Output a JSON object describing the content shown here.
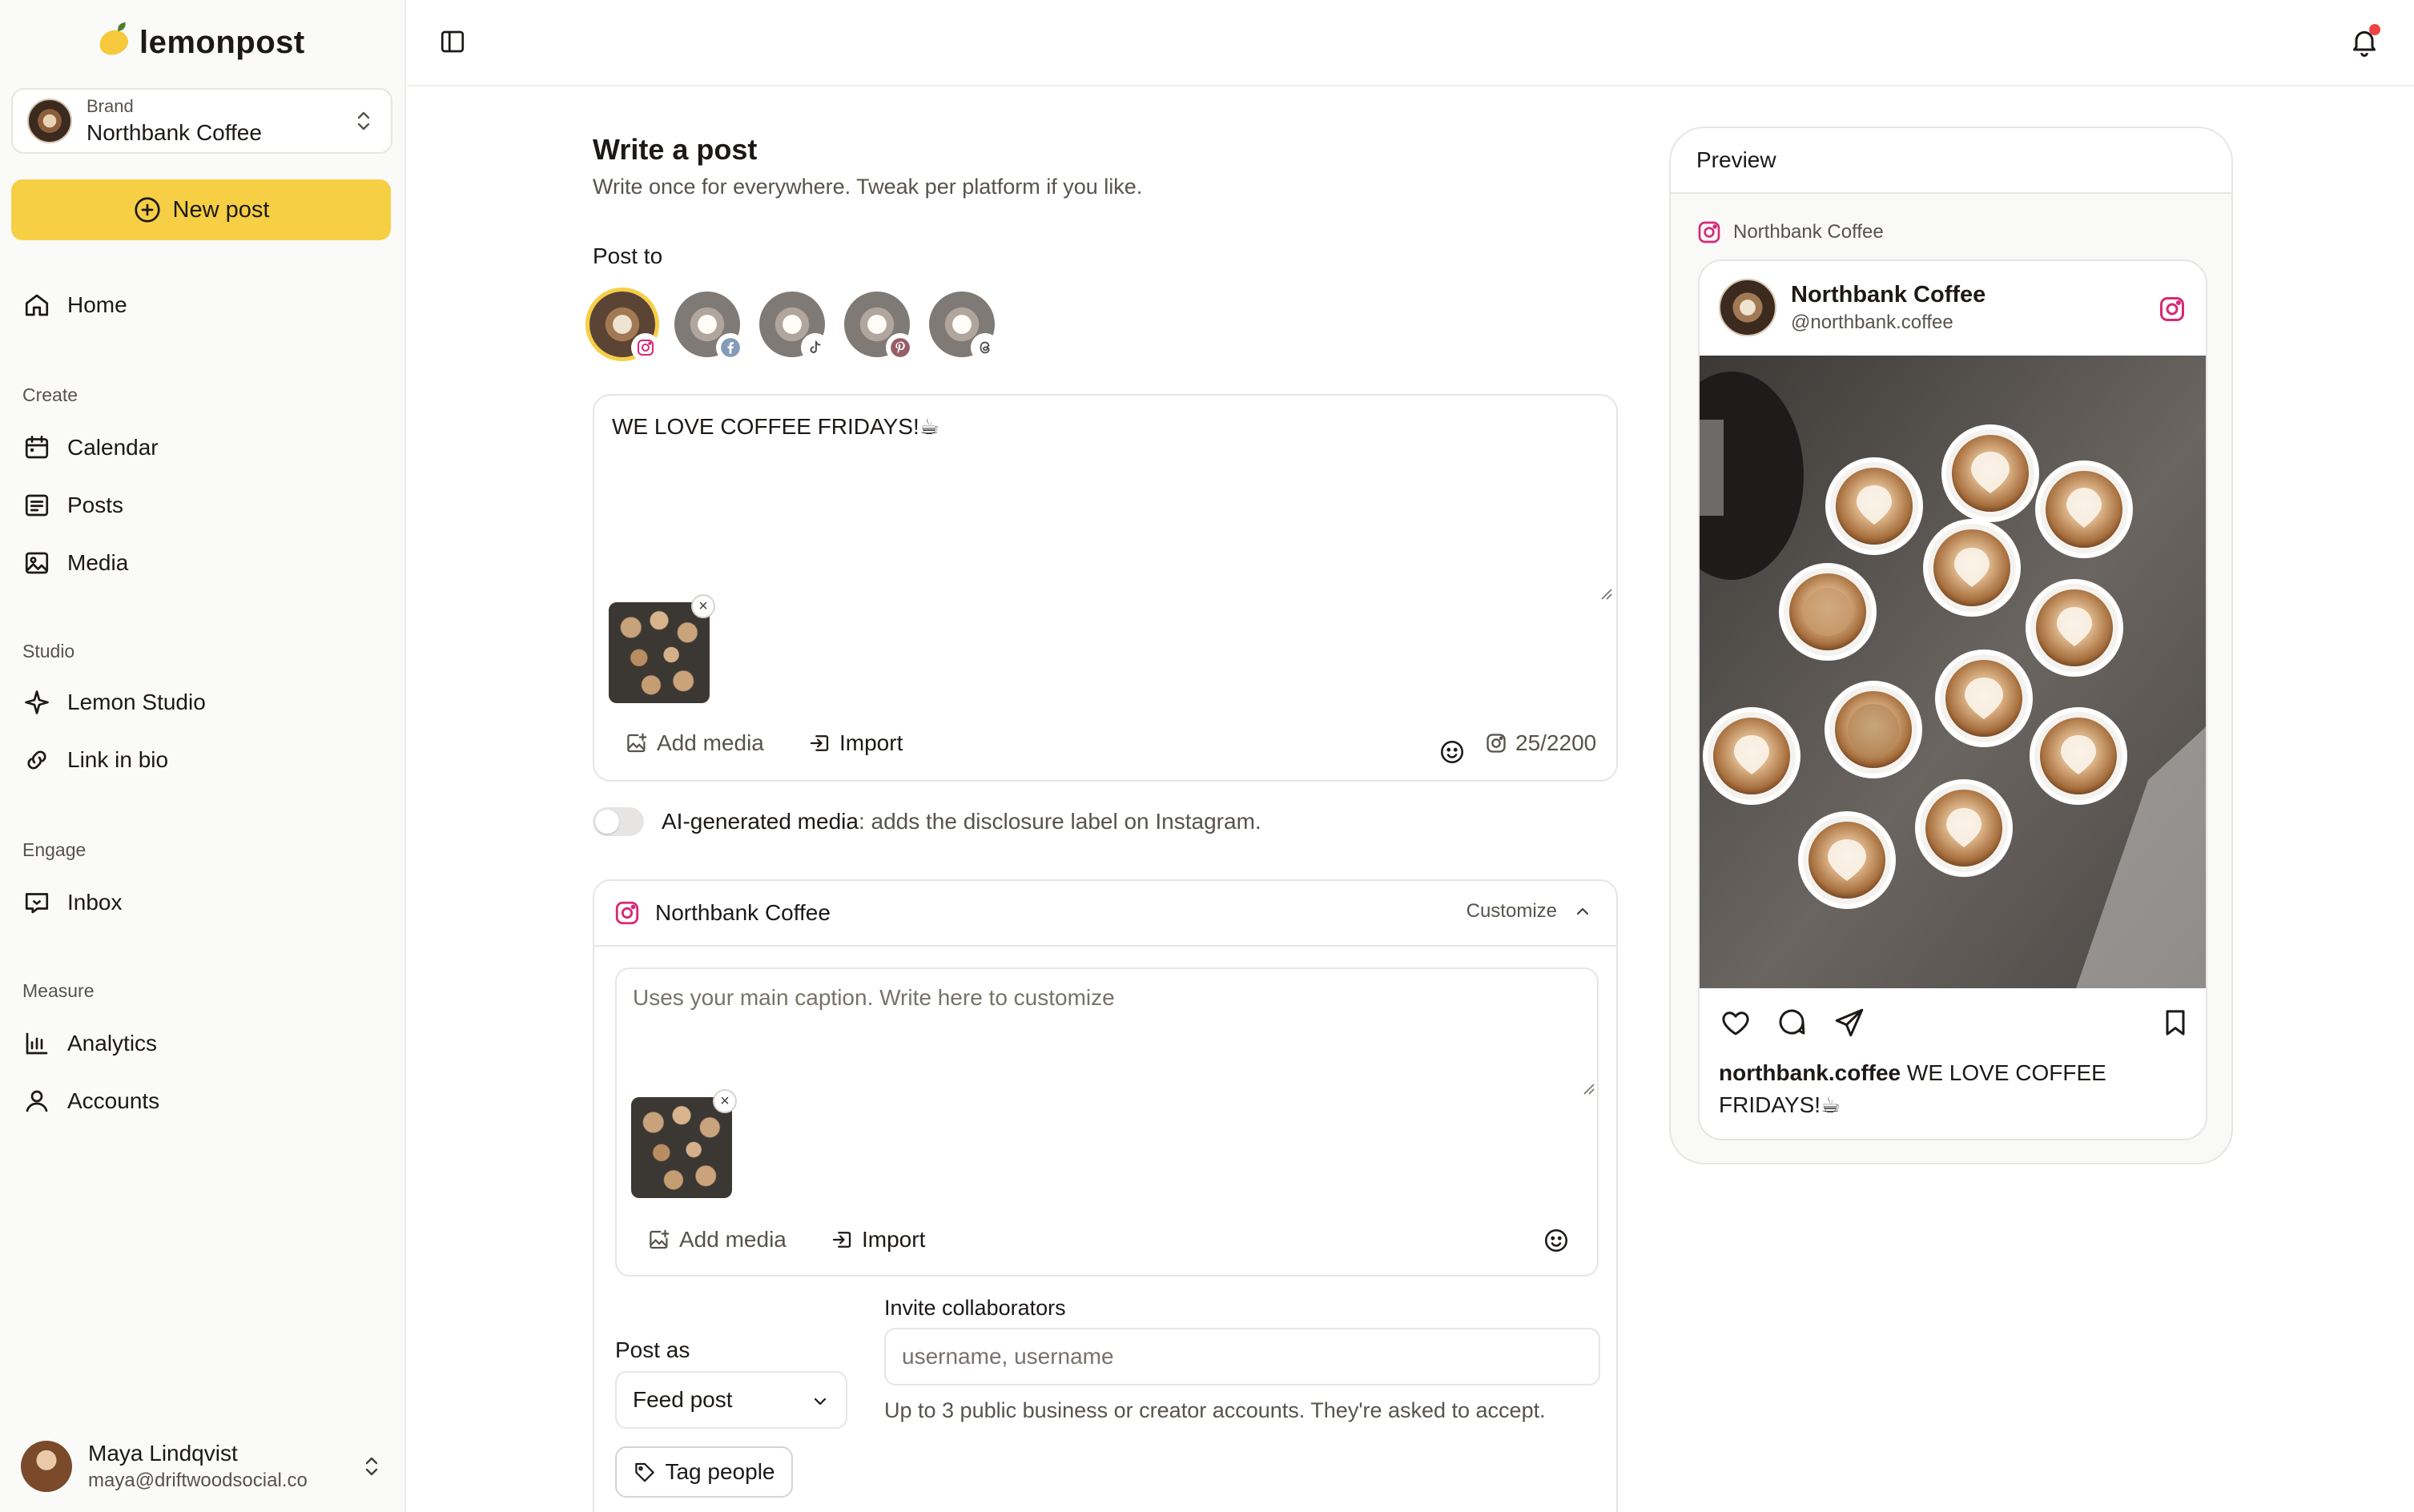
{
  "app": {
    "logo_text": "lemonpost"
  },
  "brand": {
    "label": "Brand",
    "name": "Northbank Coffee"
  },
  "new_post_label": "New post",
  "sidebar": {
    "home": "Home",
    "sections": [
      {
        "title": "Create",
        "items": [
          "Calendar",
          "Posts",
          "Media"
        ]
      },
      {
        "title": "Studio",
        "items": [
          "Lemon Studio",
          "Link in bio"
        ]
      },
      {
        "title": "Engage",
        "items": [
          "Inbox"
        ]
      },
      {
        "title": "Measure",
        "items": [
          "Analytics",
          "Accounts"
        ]
      }
    ]
  },
  "user": {
    "name": "Maya Lindqvist",
    "email": "maya@driftwoodsocial.co"
  },
  "colors": {
    "accent": "#f6cf45",
    "notification": "#ef4444",
    "instagram": "#d62976",
    "facebook": "#1877f2",
    "pinterest": "#e60023"
  },
  "editor": {
    "title": "Write a post",
    "subtitle": "Write once for everywhere. Tweak per platform if you like.",
    "post_to_label": "Post to",
    "platforms": [
      {
        "name": "Instagram",
        "icon": "instagram-icon",
        "selected": true
      },
      {
        "name": "Facebook",
        "icon": "facebook-icon",
        "selected": false
      },
      {
        "name": "TikTok",
        "icon": "tiktok-icon",
        "selected": false
      },
      {
        "name": "Pinterest",
        "icon": "pinterest-icon",
        "selected": false
      },
      {
        "name": "Threads",
        "icon": "threads-icon",
        "selected": false
      }
    ],
    "caption": "WE LOVE COFFEE FRIDAYS!☕",
    "add_media": "Add media",
    "import": "Import",
    "char_count": "25/2200",
    "ai_label_bold": "AI-generated media",
    "ai_label_rest": ": adds the disclosure label on Instagram.",
    "ai_enabled": false
  },
  "platform_section": {
    "account": "Northbank Coffee",
    "customize": "Customize",
    "caption_placeholder": "Uses your main caption. Write here to customize",
    "add_media": "Add media",
    "import": "Import",
    "post_as_label": "Post as",
    "post_as_value": "Feed post",
    "collab_label": "Invite collaborators",
    "collab_placeholder": "username, username",
    "collab_help": "Up to 3 public business or creator accounts. They're asked to accept.",
    "tag_people": "Tag people"
  },
  "preview": {
    "title": "Preview",
    "account": "Northbank Coffee",
    "display_name": "Northbank Coffee",
    "handle": "@northbank.coffee",
    "caption_user": "northbank.coffee",
    "caption_text": "WE LOVE COFFEE FRIDAYS!☕"
  }
}
